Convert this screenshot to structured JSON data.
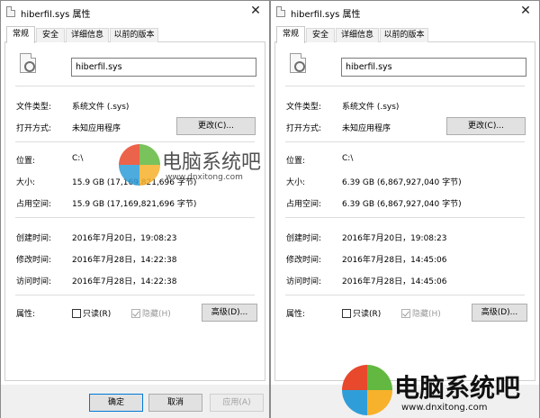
{
  "left": {
    "title": "hiberfil.sys 属性",
    "tabs": [
      "常规",
      "安全",
      "详细信息",
      "以前的版本"
    ],
    "file_name": "hiberfil.sys",
    "rows": {
      "type_label": "文件类型:",
      "type_value": "系统文件 (.sys)",
      "open_label": "打开方式:",
      "open_value": "未知应用程序",
      "change_button": "更改(C)...",
      "location_label": "位置:",
      "location_value": "C:\\",
      "size_label": "大小:",
      "size_value": "15.9 GB (17,169,821,696 字节)",
      "disk_label": "占用空间:",
      "disk_value": "15.9 GB (17,169,821,696 字节)",
      "created_label": "创建时间:",
      "created_value": "2016年7月20日，19:08:23",
      "modified_label": "修改时间:",
      "modified_value": "2016年7月28日，14:22:38",
      "accessed_label": "访问时间:",
      "accessed_value": "2016年7月28日，14:22:38",
      "attr_label": "属性:",
      "readonly": "只读(R)",
      "hidden": "隐藏(H)",
      "advanced_button": "高级(D)..."
    },
    "buttons": {
      "ok": "确定",
      "cancel": "取消",
      "apply": "应用(A)"
    }
  },
  "right": {
    "title": "hiberfil.sys 属性",
    "tabs": [
      "常规",
      "安全",
      "详细信息",
      "以前的版本"
    ],
    "file_name": "hiberfil.sys",
    "rows": {
      "type_label": "文件类型:",
      "type_value": "系统文件 (.sys)",
      "open_label": "打开方式:",
      "open_value": "未知应用程序",
      "change_button": "更改(C)...",
      "location_label": "位置:",
      "location_value": "C:\\",
      "size_label": "大小:",
      "size_value": "6.39 GB (6,867,927,040 字节)",
      "disk_label": "占用空间:",
      "disk_value": "6.39 GB (6,867,927,040 字节)",
      "created_label": "创建时间:",
      "created_value": "2016年7月20日，19:08:23",
      "modified_label": "修改时间:",
      "modified_value": "2016年7月28日，14:45:06",
      "accessed_label": "访问时间:",
      "accessed_value": "2016年7月28日，14:45:06",
      "attr_label": "属性:",
      "readonly": "只读(R)",
      "hidden": "隐藏(H)",
      "advanced_button": "高级(D)..."
    }
  },
  "watermark": {
    "cn": "电脑系统吧",
    "en": "www.dnxitong.com"
  },
  "colors": {
    "ok_border": "#0078d7",
    "logo_red": "#e8482b",
    "logo_green": "#62b840",
    "logo_blue": "#2f9ed8",
    "logo_yellow": "#f7b12b"
  }
}
